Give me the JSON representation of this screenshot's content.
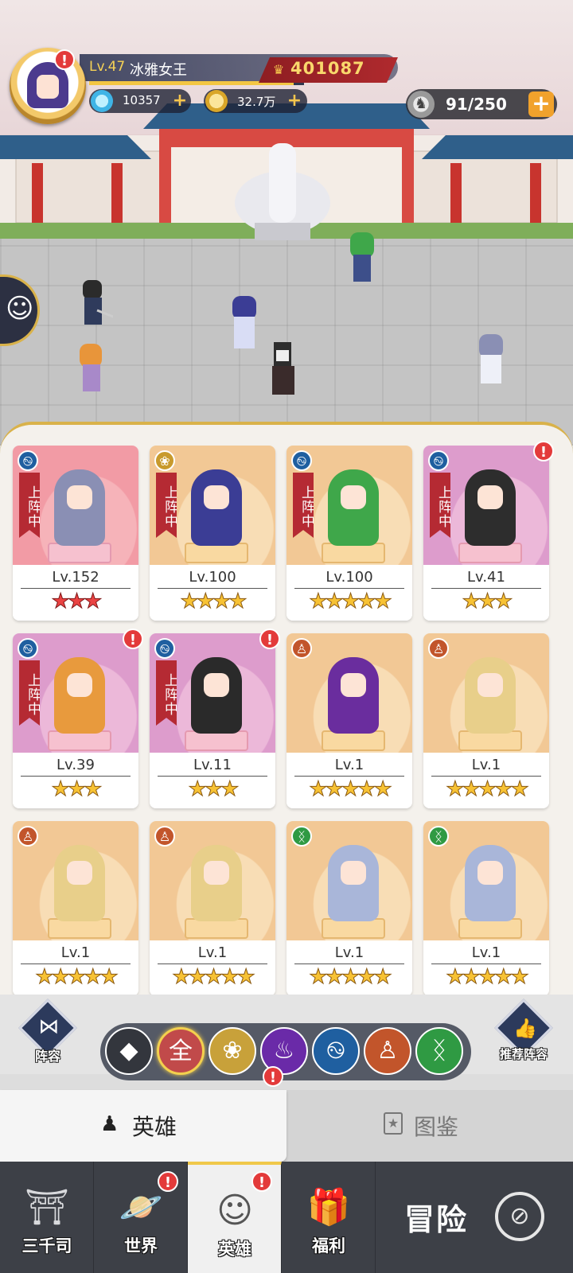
{
  "player": {
    "level": "Lv.47",
    "name": "冰雅女王",
    "power": "401087",
    "xp_fraction": 0.95
  },
  "resources": {
    "diamonds": "10357",
    "gold": "32.7万",
    "plus": "+"
  },
  "capacity": {
    "value": "91/250",
    "plus": "+"
  },
  "alert_mark": "!",
  "deployed_label": "上阵中",
  "heroes": [
    {
      "level": "Lv.152",
      "stars": "★★★",
      "faction": "water",
      "deployed": true,
      "alert": false,
      "theme": "pink",
      "color": "#8a8fb4",
      "star_color": "red"
    },
    {
      "level": "Lv.100",
      "stars": "★★★★",
      "faction": "lotus",
      "deployed": true,
      "alert": false,
      "theme": "gold",
      "color": "#3b3d95",
      "star_color": "gold"
    },
    {
      "level": "Lv.100",
      "stars": "★★★★★",
      "faction": "water",
      "deployed": true,
      "alert": false,
      "theme": "gold",
      "color": "#3fa74a",
      "star_color": "gold"
    },
    {
      "level": "Lv.41",
      "stars": "★★★",
      "faction": "water",
      "deployed": true,
      "alert": true,
      "theme": "violet",
      "color": "#2d2d2d",
      "star_color": "gold"
    },
    {
      "level": "Lv.39",
      "stars": "★★★",
      "faction": "water",
      "deployed": true,
      "alert": true,
      "theme": "violet",
      "color": "#e89a3d",
      "star_color": "gold"
    },
    {
      "level": "Lv.11",
      "stars": "★★★",
      "faction": "water",
      "deployed": true,
      "alert": true,
      "theme": "violet",
      "color": "#2a2a2a",
      "star_color": "gold"
    },
    {
      "level": "Lv.1",
      "stars": "★★★★★",
      "faction": "zen",
      "deployed": false,
      "alert": false,
      "theme": "gold",
      "color": "#6a2d9e",
      "star_color": "gold"
    },
    {
      "level": "Lv.1",
      "stars": "★★★★★",
      "faction": "zen",
      "deployed": false,
      "alert": false,
      "theme": "gold",
      "color": "#e8cf8a",
      "star_color": "gold"
    },
    {
      "level": "Lv.1",
      "stars": "★★★★★",
      "faction": "zen",
      "deployed": false,
      "alert": false,
      "theme": "gold",
      "color": "#e8cf8a",
      "star_color": "gold"
    },
    {
      "level": "Lv.1",
      "stars": "★★★★★",
      "faction": "zen",
      "deployed": false,
      "alert": false,
      "theme": "gold",
      "color": "#e8cf8a",
      "star_color": "gold"
    },
    {
      "level": "Lv.1",
      "stars": "★★★★★",
      "faction": "dna",
      "deployed": false,
      "alert": false,
      "theme": "gold",
      "color": "#a9b6d9",
      "star_color": "gold"
    },
    {
      "level": "Lv.1",
      "stars": "★★★★★",
      "faction": "dna",
      "deployed": false,
      "alert": false,
      "theme": "gold",
      "color": "#a9b6d9",
      "star_color": "gold"
    }
  ],
  "faction_icons": {
    "water": "࿊",
    "lotus": "❀",
    "zen": "♙",
    "dna": "ᛝ"
  },
  "filter": {
    "formation_label": "阵容",
    "recommend_label": "推荐阵容",
    "chips": [
      {
        "name": "class",
        "glyph": "◆",
        "bg": "#33363d",
        "selected": false
      },
      {
        "name": "all",
        "glyph": "全",
        "bg": "#c14a4a",
        "selected": true
      },
      {
        "name": "lotus",
        "glyph": "❀",
        "bg": "#c8a13a",
        "selected": false
      },
      {
        "name": "flame",
        "glyph": "♨",
        "bg": "#6a2aa8",
        "selected": false
      },
      {
        "name": "water",
        "glyph": "࿊",
        "bg": "#1f5fa0",
        "selected": false
      },
      {
        "name": "zen",
        "glyph": "♙",
        "bg": "#c2552b",
        "selected": false
      },
      {
        "name": "dna",
        "glyph": "ᛝ",
        "bg": "#2f9a43",
        "selected": false
      }
    ]
  },
  "tabs": {
    "heroes": "英雄",
    "codex": "图鉴"
  },
  "nav": {
    "items": [
      {
        "label": "三千司",
        "icon": "⛩",
        "alert": false
      },
      {
        "label": "世界",
        "icon": "🪐",
        "alert": true
      },
      {
        "label": "英雄",
        "icon": "☺",
        "alert": true
      },
      {
        "label": "福利",
        "icon": "🎁",
        "alert": false
      }
    ],
    "adventure": "冒险"
  },
  "colors": {
    "accent_gold": "#f3c643",
    "alert_red": "#e33a3a",
    "ribbon_red": "#b52a33",
    "nav_bg": "#3d4047"
  }
}
